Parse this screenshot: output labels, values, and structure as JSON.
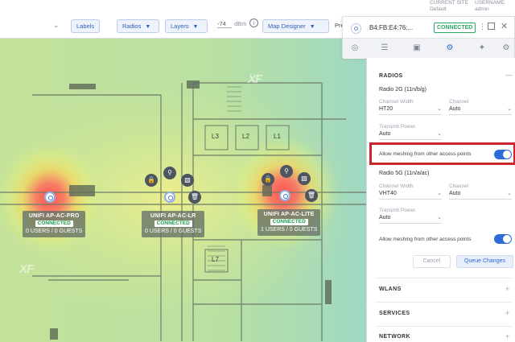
{
  "toolbar": {
    "labels_btn": "Labels",
    "radios_btn": "Radios",
    "layers_btn": "Layers",
    "map_designer_btn": "Map Designer",
    "dbm_value": "-74",
    "dbm_unit": "dBm",
    "pre_text": "Pre",
    "current_site_label": "CURRENT SITE",
    "current_site_value": "Default",
    "username_label": "USERNAME",
    "username_value": "admin"
  },
  "device": {
    "mac": "B4:FB:E4:76:...",
    "status": "CONNECTED"
  },
  "aps": [
    {
      "name": "UNIFI AP-AC-PRO",
      "status": "CONNECTED",
      "users": "0 USERS / 0 GUESTS"
    },
    {
      "name": "UNIFI AP-AC-LR",
      "status": "CONNECTED",
      "users": "0 USERS / 0 GUESTS"
    },
    {
      "name": "UNIFI AP-AC-LITE",
      "status": "CONNECTED",
      "users": "1 USERS / 0 GUESTS"
    }
  ],
  "rooms": [
    "L3",
    "L2",
    "L1",
    "L7"
  ],
  "watermark": "XF",
  "panel": {
    "radios_head": "RADIOS",
    "radio2g": {
      "title": "Radio 2G (11n/b/g)",
      "channel_width_label": "Channel Width",
      "channel_width_value": "HT20",
      "channel_label": "Channel",
      "channel_value": "Auto",
      "tx_power_label": "Transmit Power",
      "tx_power_value": "Auto",
      "meshing_label": "Allow meshing from other access points"
    },
    "radio5g": {
      "title": "Radio 5G (11n/a/ac)",
      "channel_width_label": "Channel Width",
      "channel_width_value": "VHT40",
      "channel_label": "Channel",
      "channel_value": "Auto",
      "tx_power_label": "Transmit Power",
      "tx_power_value": "Auto",
      "meshing_label": "Allow meshing from other access points"
    },
    "cancel_btn": "Cancel",
    "queue_btn": "Queue Changes",
    "wlans_head": "WLANS",
    "services_head": "SERVICES",
    "network_head": "NETWORK",
    "plus": "+"
  },
  "colors": {
    "accent": "#2d6bd6",
    "connected": "#2ea860",
    "highlight": "#c8262c"
  }
}
